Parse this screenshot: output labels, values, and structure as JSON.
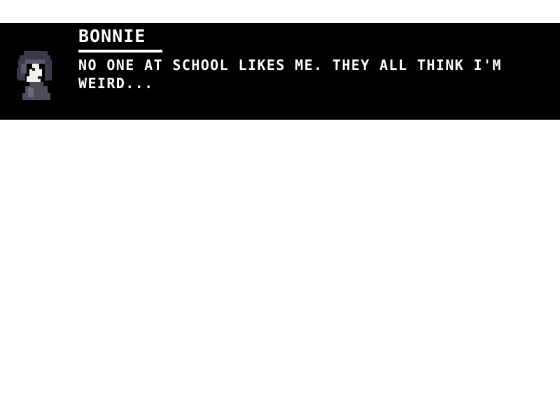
{
  "dialog": {
    "speaker": "BONNIE",
    "text": "NO ONE AT SCHOOL LIKES ME. THEY ALL THINK I'M WEIRD...",
    "portrait_icon": "bonnie-portrait-icon"
  },
  "colors": {
    "background": "#ffffff",
    "dialog_background": "#000000",
    "text": "#ffffff"
  }
}
